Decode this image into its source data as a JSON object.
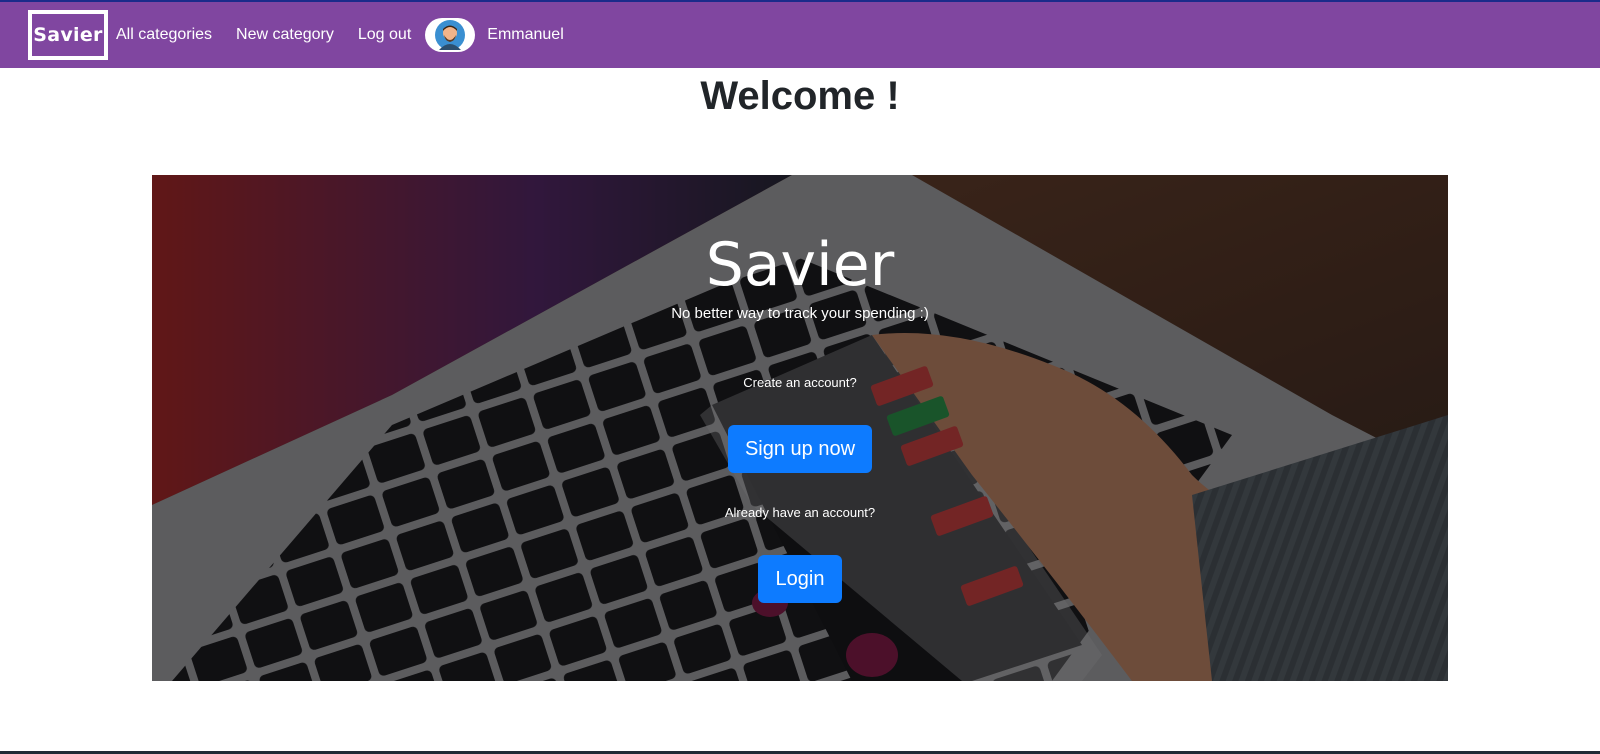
{
  "navbar": {
    "brand": "Savier",
    "links": [
      "All categories",
      "New category",
      "Log out"
    ],
    "username": "Emmanuel",
    "avatar_icon": "user-avatar-icon",
    "background_color": "#8046a0"
  },
  "main": {
    "heading": "Welcome !"
  },
  "hero": {
    "title": "Savier",
    "tagline": "No better way to track your spending :)",
    "create_prompt": "Create an account?",
    "signup_label": "Sign up now",
    "login_prompt": "Already have an account?",
    "login_label": "Login",
    "button_color": "#0d7bff",
    "background_image": "laptop-and-stock-app-phone-photo"
  }
}
